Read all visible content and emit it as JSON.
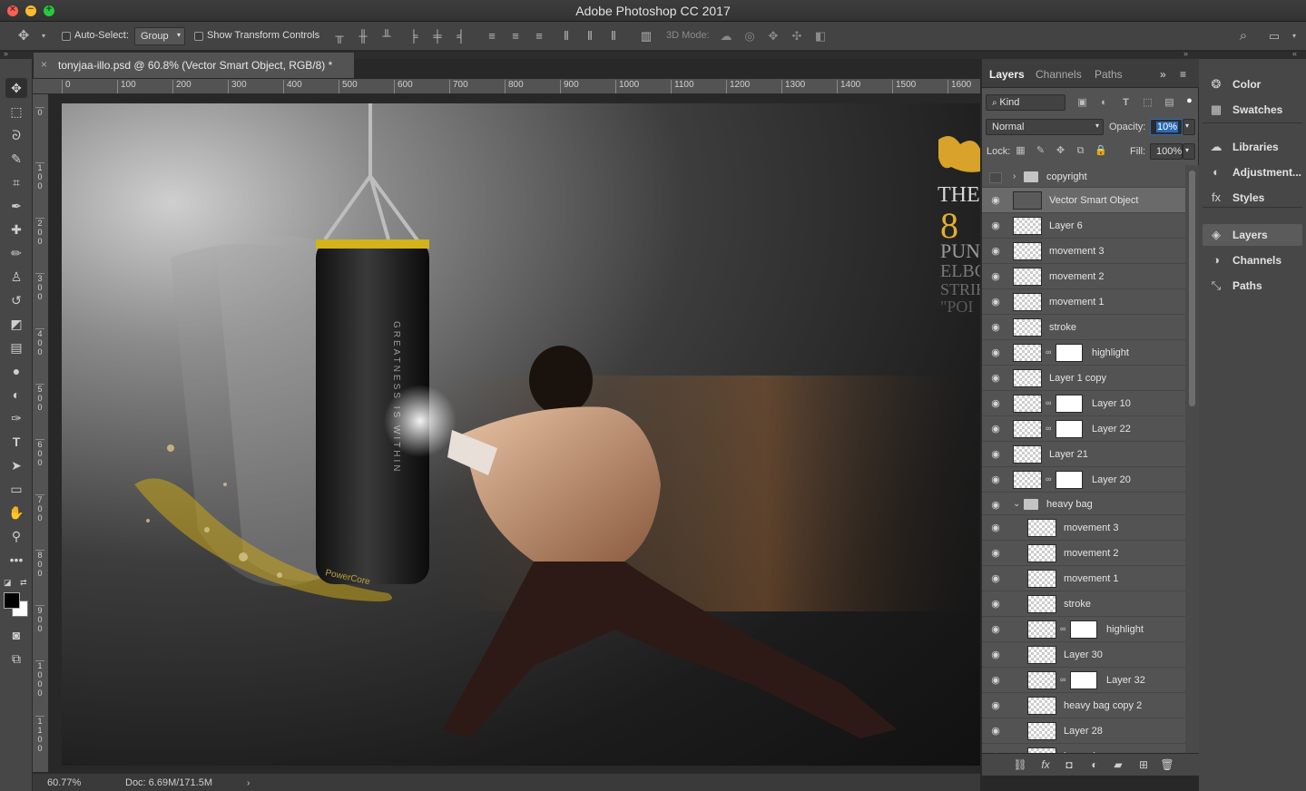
{
  "app": {
    "title": "Adobe Photoshop CC 2017"
  },
  "options": {
    "auto_select_label": "Auto-Select:",
    "auto_select_value": "Group",
    "show_transform_label": "Show Transform Controls",
    "mode_3d_label": "3D Mode:"
  },
  "document": {
    "tab_title": "tonyjaa-illo.psd @ 60.8% (Vector Smart Object, RGB/8) *",
    "zoom": "60.77%",
    "doc_size": "Doc: 6.69M/171.5M"
  },
  "ruler": {
    "top": [
      "0",
      "100",
      "200",
      "300",
      "400",
      "500",
      "600",
      "700",
      "800",
      "900",
      "1000",
      "1100",
      "1200",
      "1300",
      "1400",
      "1500",
      "1600"
    ],
    "left": [
      "0",
      "1\n0\n0",
      "2\n0\n0",
      "3\n0\n0",
      "4\n0\n0",
      "5\n0\n0",
      "6\n0\n0",
      "7\n0\n0",
      "8\n0\n0",
      "9\n0\n0",
      "1\n0\n0\n0",
      "1\n1\n0\n0"
    ]
  },
  "artwork": {
    "bag_text": "GREATNESS IS WITHIN",
    "bag_brand": "PowerCore",
    "poster_lines": [
      "THE",
      "8",
      "PUN",
      "ELBC",
      "STRIK",
      "\"POI"
    ]
  },
  "layers_panel": {
    "tabs": [
      "Layers",
      "Channels",
      "Paths"
    ],
    "filter_kind": "Kind",
    "blend_mode": "Normal",
    "opacity_label": "Opacity:",
    "opacity_value": "10%",
    "lock_label": "Lock:",
    "fill_label": "Fill:",
    "fill_value": "100%",
    "layers": [
      {
        "name": "copyright",
        "type": "group",
        "visible": false,
        "expanded": false
      },
      {
        "name": "Vector Smart Object",
        "type": "smart",
        "selected": true
      },
      {
        "name": "Layer 6"
      },
      {
        "name": "movement 3"
      },
      {
        "name": "movement 2"
      },
      {
        "name": "movement 1"
      },
      {
        "name": "stroke"
      },
      {
        "name": "highlight",
        "mask": true
      },
      {
        "name": "Layer 1 copy"
      },
      {
        "name": "Layer 10",
        "mask": true
      },
      {
        "name": "Layer 22",
        "mask": true
      },
      {
        "name": "Layer 21"
      },
      {
        "name": "Layer 20",
        "mask": true
      },
      {
        "name": "heavy bag",
        "type": "group",
        "expanded": true
      },
      {
        "name": "movement 3",
        "indent": true
      },
      {
        "name": "movement 2",
        "indent": true
      },
      {
        "name": "movement 1",
        "indent": true
      },
      {
        "name": "stroke",
        "indent": true
      },
      {
        "name": "highlight",
        "indent": true,
        "mask": true
      },
      {
        "name": "Layer 30",
        "indent": true
      },
      {
        "name": "Layer 32",
        "indent": true,
        "mask": true
      },
      {
        "name": "heavy bag copy 2",
        "indent": true
      },
      {
        "name": "Layer 28",
        "indent": true
      },
      {
        "name": "heavy bag",
        "indent": true
      }
    ]
  },
  "dock": {
    "items": [
      {
        "label": "Color",
        "icon": "color-icon"
      },
      {
        "label": "Swatches",
        "icon": "swatches-icon"
      },
      {
        "label": "Libraries",
        "icon": "libraries-icon"
      },
      {
        "label": "Adjustment...",
        "icon": "adjustments-icon"
      },
      {
        "label": "Styles",
        "icon": "styles-icon"
      },
      {
        "label": "Layers",
        "icon": "layers-icon"
      },
      {
        "label": "Channels",
        "icon": "channels-icon"
      },
      {
        "label": "Paths",
        "icon": "paths-icon"
      }
    ]
  },
  "colors": {
    "accent": "#2a6ab8",
    "foreground": "#000000",
    "background": "#ffffff"
  }
}
